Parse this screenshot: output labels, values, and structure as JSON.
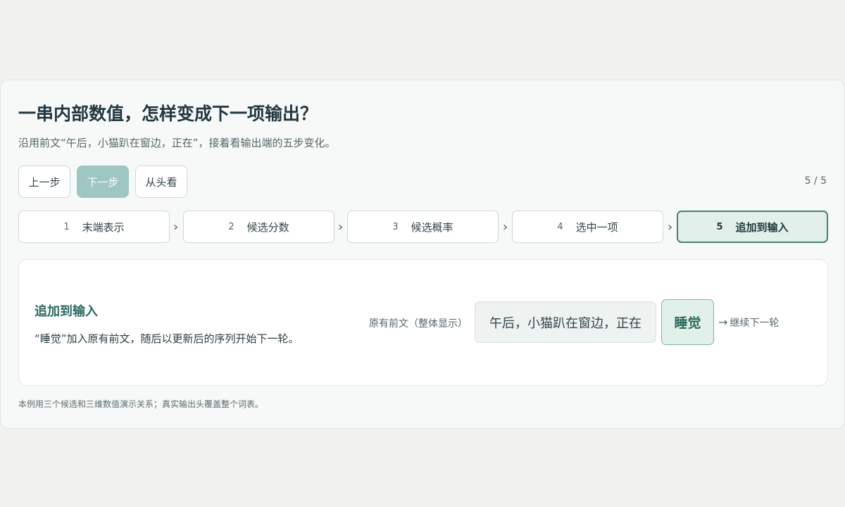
{
  "header": {
    "title": "一串内部数值，怎样变成下一项输出？",
    "subtitle": "沿用前文“午后，小猫趴在窗边，正在”，接着看输出端的五步变化。"
  },
  "controls": {
    "prev_label": "上一步",
    "next_label": "下一步",
    "restart_label": "从头看",
    "counter": "5 / 5"
  },
  "steps": [
    {
      "num": "1",
      "label": "末端表示"
    },
    {
      "num": "2",
      "label": "候选分数"
    },
    {
      "num": "3",
      "label": "候选概率"
    },
    {
      "num": "4",
      "label": "选中一项"
    },
    {
      "num": "5",
      "label": "追加到输入",
      "active": true
    }
  ],
  "panel": {
    "title": "追加到输入",
    "description": "“睡觉”加入原有前文，随后以更新后的序列开始下一轮。",
    "context_label": "原有前文（整体显示）",
    "context_text": "午后，小猫趴在窗边，正在",
    "token": "睡觉",
    "continue_arrow": "→",
    "continue_text": "继续下一轮"
  },
  "footnote": "本例用三个候选和三维数值演示关系；真实输出头覆盖整个词表。",
  "colors": {
    "accent": "#3f8378",
    "accent_light": "#e2efeb",
    "next_button": "#9ec6c3",
    "background": "#f1f2ef"
  }
}
